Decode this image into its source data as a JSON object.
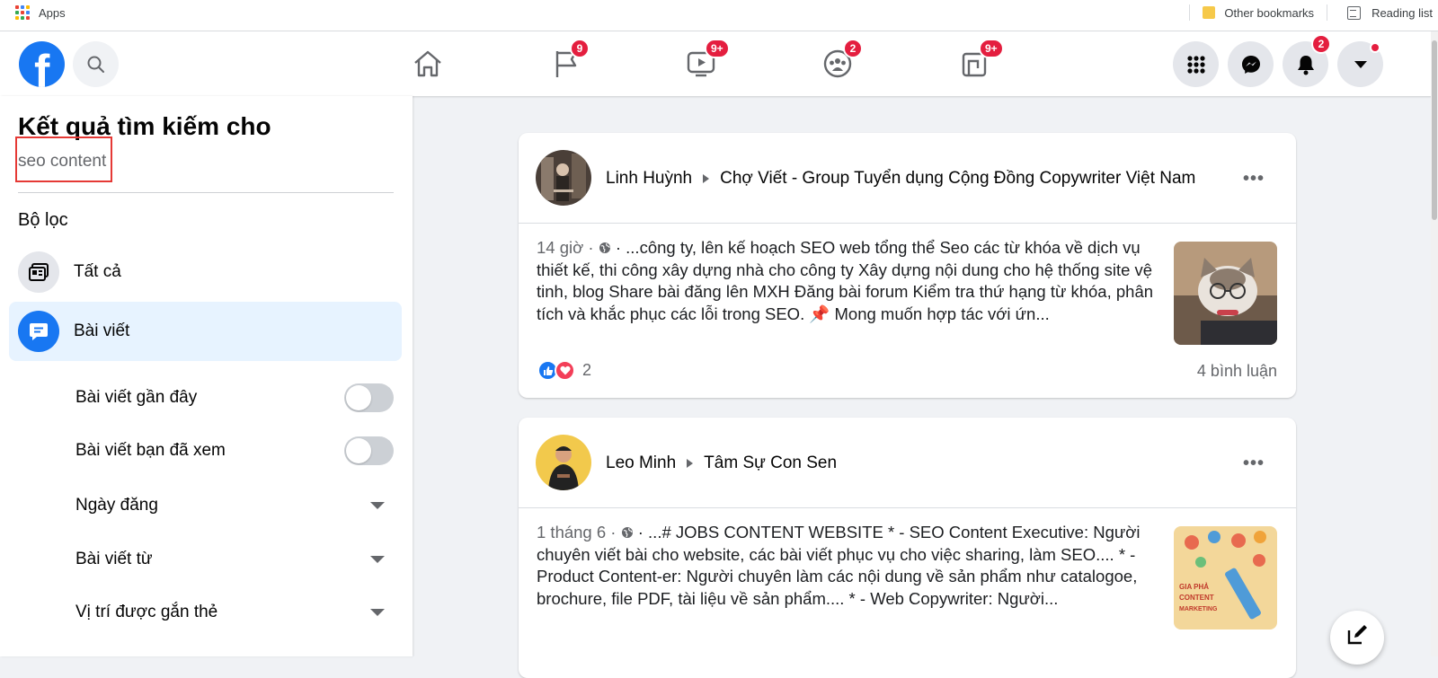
{
  "browser": {
    "apps_label": "Apps",
    "other_bookmarks": "Other bookmarks",
    "reading_list": "Reading list"
  },
  "header": {
    "badges": {
      "pages": "9",
      "watch": "9+",
      "groups": "2",
      "gaming": "9+",
      "notifications": "2"
    }
  },
  "sidebar": {
    "title": "Kết quả tìm kiếm cho",
    "query": "seo content",
    "filter_heading": "Bộ lọc",
    "categories": [
      {
        "label": "Tất cả",
        "icon": "feed-icon"
      },
      {
        "label": "Bài viết",
        "icon": "post-icon"
      }
    ],
    "sub_filters": [
      {
        "label": "Bài viết gần đây",
        "control": "toggle"
      },
      {
        "label": "Bài viết bạn đã xem",
        "control": "toggle"
      },
      {
        "label": "Ngày đăng",
        "control": "dropdown"
      },
      {
        "label": "Bài viết từ",
        "control": "dropdown"
      },
      {
        "label": "Vị trí được gắn thẻ",
        "control": "dropdown"
      }
    ]
  },
  "posts": [
    {
      "author": "Linh Huỳnh",
      "group": "Chợ Viết - Group Tuyển dụng Cộng Đồng Copywriter Việt Nam",
      "meta": "14 giờ · ",
      "text": " · ...công ty, lên kế hoạch SEO web tổng thể Seo các từ khóa về dịch vụ thiết kế, thi công xây dựng nhà cho công ty Xây dựng nội dung cho hệ thống site vệ tinh, blog Share bài đăng lên MXH Đăng bài forum Kiểm tra thứ hạng từ khóa, phân tích và khắc phục các lỗi trong SEO. 📌 Mong muốn hợp tác với ứn...",
      "reactions": "2",
      "comments": "4 bình luận"
    },
    {
      "author": "Leo Minh",
      "group": "Tâm Sự Con Sen",
      "meta": "1 tháng 6 · ",
      "text": " · ...# JOBS CONTENT WEBSITE * - SEO Content Executive: Người chuyên viết bài cho website, các bài viết phục vụ cho việc sharing, làm SEO.... * - Product Content-er: Người chuyên làm các nội dung về sản phẩm như catalogoe, brochure, file PDF, tài liệu về sản phẩm.... * - Web Copywriter: Người...",
      "thumb_text": "GIA PHẢ CONTENT MARKETING"
    }
  ]
}
